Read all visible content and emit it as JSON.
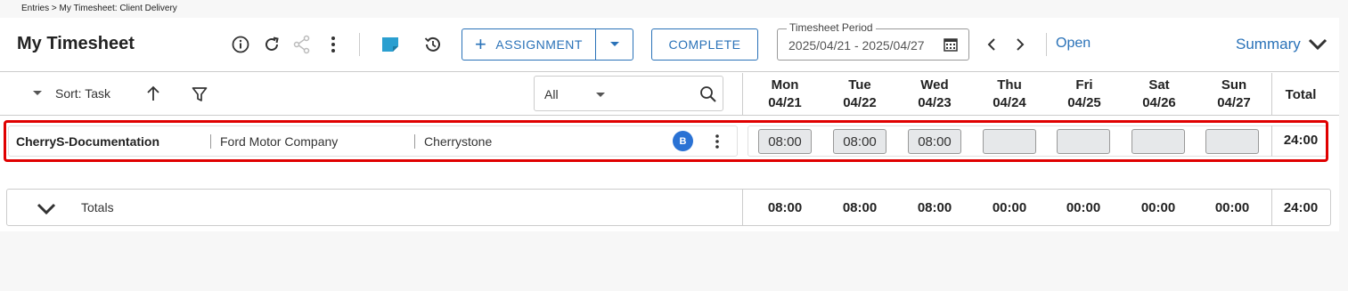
{
  "breadcrumb": "Entries > My Timesheet: Client Delivery",
  "header": {
    "title": "My Timesheet",
    "assignment_label": "ASSIGNMENT",
    "complete_label": "COMPLETE",
    "period_legend": "Timesheet Period",
    "period_value": "2025/04/21 - 2025/04/27",
    "status_link": "Open",
    "summary_label": "Summary"
  },
  "toolbar": {
    "sort_label": "Sort: Task",
    "filter_value": "All"
  },
  "days": [
    {
      "name": "Mon",
      "date": "04/21"
    },
    {
      "name": "Tue",
      "date": "04/22"
    },
    {
      "name": "Wed",
      "date": "04/23"
    },
    {
      "name": "Thu",
      "date": "04/24"
    },
    {
      "name": "Fri",
      "date": "04/25"
    },
    {
      "name": "Sat",
      "date": "04/26"
    },
    {
      "name": "Sun",
      "date": "04/27"
    }
  ],
  "total_header": "Total",
  "row": {
    "task": "CherryS-Documentation",
    "client": "Ford Motor Company",
    "project": "Cherrystone",
    "badge": "B",
    "hours": [
      "08:00",
      "08:00",
      "08:00",
      "",
      "",
      "",
      ""
    ],
    "total": "24:00"
  },
  "totals": {
    "label": "Totals",
    "values": [
      "08:00",
      "08:00",
      "08:00",
      "00:00",
      "00:00",
      "00:00",
      "00:00"
    ],
    "grand_total": "24:00"
  },
  "icons": [
    "info-icon",
    "refresh-icon",
    "share-icon",
    "more-vert-icon",
    "note-icon",
    "history-icon",
    "chevron-down-icon",
    "calendar-icon",
    "chevron-left-icon",
    "chevron-right-icon",
    "arrow-up-icon",
    "filter-icon",
    "search-icon"
  ],
  "colors": {
    "accent": "#2a72b8",
    "highlight": "#e00000",
    "badge": "#2a72d4"
  }
}
